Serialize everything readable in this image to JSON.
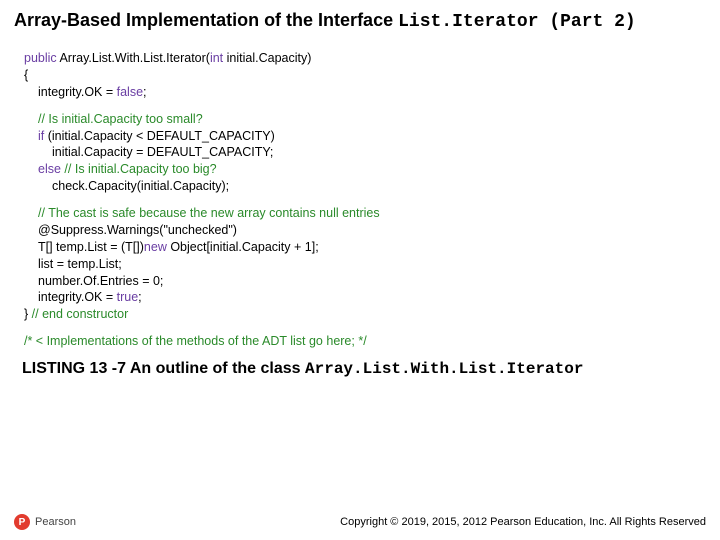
{
  "title": {
    "t1": "Array-Based Implementation of the Interface ",
    "t2": "List.Iterator (Part 2)"
  },
  "code": {
    "l1a": "public",
    "l1b": " Array.List.With.List.Iterator(",
    "l1c": "int",
    "l1d": " initial.Capacity)",
    "l2": "{",
    "l3a": "integrity.OK = ",
    "l3b": "false",
    "l3c": ";",
    "l4": "// Is initial.Capacity too small?",
    "l5a": "if",
    "l5b": " (initial.Capacity < DEFAULT_CAPACITY)",
    "l6": "initial.Capacity = DEFAULT_CAPACITY;",
    "l7a": "else",
    "l7b": " ",
    "l7c": "// Is initial.Capacity too big?",
    "l8": "check.Capacity(initial.Capacity);",
    "l9": "// The cast is safe because the new array contains null entries",
    "l10": "@Suppress.Warnings(\"unchecked\")",
    "l11a": "T[] temp.List = (T[])",
    "l11b": "new",
    "l11c": " Object[initial.Capacity + 1];",
    "l12": "list = temp.List;",
    "l13": "number.Of.Entries = 0;",
    "l14a": "integrity.OK = ",
    "l14b": "true",
    "l14c": ";",
    "l15a": "} ",
    "l15b": "// end constructor",
    "l16": "/* < Implementations of the methods of the ADT list go here; */"
  },
  "listing": {
    "a": "LISTING 13 -7 An outline of the class ",
    "b": "Array.List.With.List.Iterator"
  },
  "footer": {
    "p": "P",
    "brand": "Pearson",
    "copy": "Copyright © 2019, 2015, 2012 Pearson Education, Inc. All Rights Reserved"
  }
}
